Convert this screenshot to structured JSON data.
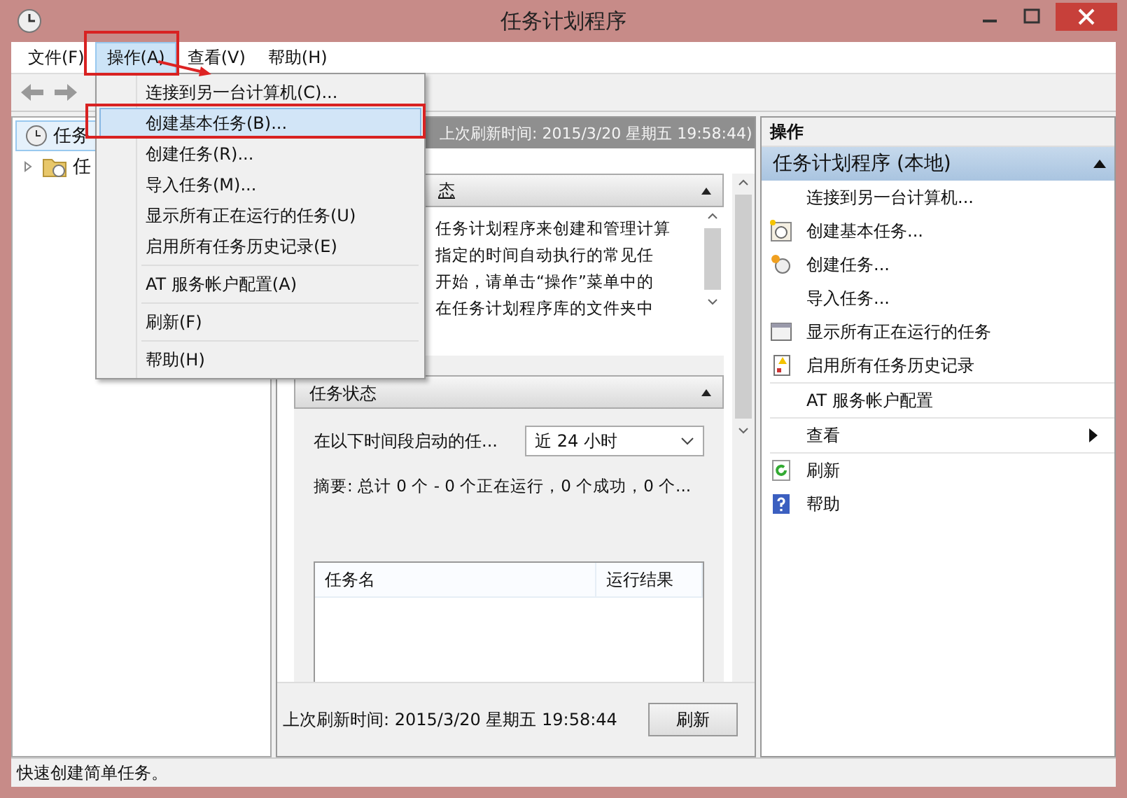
{
  "window": {
    "title": "任务计划程序"
  },
  "menubar": [
    {
      "label": "文件(F)",
      "selected": false
    },
    {
      "label": "操作(A)",
      "selected": true
    },
    {
      "label": "查看(V)",
      "selected": false
    },
    {
      "label": "帮助(H)",
      "selected": false
    }
  ],
  "menu": {
    "groups": [
      [
        {
          "label": "连接到另一台计算机(C)...",
          "selected": false
        },
        {
          "label": "创建基本任务(B)...",
          "selected": true
        },
        {
          "label": "创建任务(R)...",
          "selected": false
        },
        {
          "label": "导入任务(M)...",
          "selected": false
        },
        {
          "label": "显示所有正在运行的任务(U)",
          "selected": false
        },
        {
          "label": "启用所有任务历史记录(E)",
          "selected": false
        }
      ],
      [
        {
          "label": "AT 服务帐户配置(A)",
          "selected": false
        }
      ],
      [
        {
          "label": "刷新(F)",
          "selected": false
        }
      ],
      [
        {
          "label": "帮助(H)",
          "selected": false
        }
      ]
    ]
  },
  "tree": [
    {
      "label": "任务",
      "selected": true,
      "expanded": true,
      "children": [
        {
          "label": "任",
          "selected": false,
          "expanded": false
        }
      ]
    }
  ],
  "center": {
    "header": "上次刷新时间: 2015/3/20 星期五 19:58:44)",
    "overview": {
      "title": "态",
      "lines": [
        "任务计划程序来创建和管理计算",
        "指定的时间自动执行的常见任",
        "开始，请单击“操作”菜单中的",
        "在任务计划程序库的文件夹中"
      ]
    },
    "status": {
      "title": "任务状态",
      "period_label": "在以下时间段启动的任...",
      "period_value": "近 24 小时",
      "summary": "摘要: 总计 0 个 - 0 个正在运行，0 个成功，0 个...",
      "columns": [
        "任务名",
        "运行结果"
      ]
    },
    "last_refresh": "上次刷新时间: 2015/3/20 星期五 19:58:44",
    "refresh_button": "刷新"
  },
  "actions": {
    "title": "操作",
    "group": "任务计划程序 (本地)",
    "items": [
      {
        "label": "连接到另一台计算机...",
        "kind": "none"
      },
      {
        "label": "创建基本任务...",
        "kind": "basic-task"
      },
      {
        "label": "创建任务...",
        "kind": "task"
      },
      {
        "label": "导入任务...",
        "kind": "none"
      },
      {
        "label": "显示所有正在运行的任务",
        "kind": "running"
      },
      {
        "label": "启用所有任务历史记录",
        "kind": "history"
      },
      {
        "label": "AT 服务帐户配置",
        "kind": "none"
      },
      {
        "label": "查看",
        "kind": "submenu"
      },
      {
        "label": "刷新",
        "kind": "refresh"
      },
      {
        "label": "帮助",
        "kind": "help"
      }
    ]
  },
  "status_bar": "快速创建简单任务。"
}
